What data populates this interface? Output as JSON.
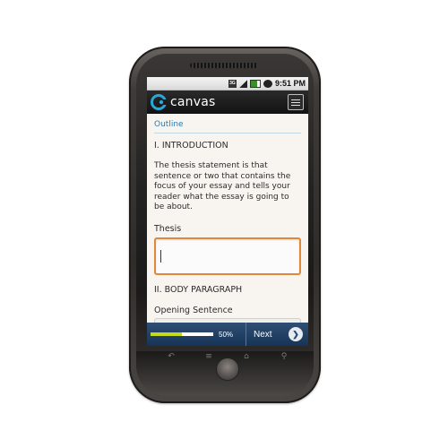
{
  "statusbar": {
    "network": "3G",
    "time": "9:51 PM"
  },
  "appbar": {
    "brand": "canvas",
    "menu_icon": "menu-icon",
    "brand_color": "#2aa7d6"
  },
  "outline": {
    "title": "Outline",
    "section1_heading": "I. INTRODUCTION",
    "paragraph": "The thesis statement is that sentence or two that contains the focus of your essay and tells your reader what the essay is going to be about.",
    "thesis_label": "Thesis",
    "thesis_value": "",
    "section2_heading": "II. BODY PARAGRAPH",
    "opening_label": "Opening Sentence",
    "opening_value": ""
  },
  "footer": {
    "progress_percent": 50,
    "progress_text": "50%",
    "next_label": "Next",
    "next_icon": "chevron-right-icon",
    "accent": "#c5d91c"
  },
  "hardware_keys": [
    "back-icon",
    "menu-icon",
    "home-icon",
    "search-icon"
  ]
}
